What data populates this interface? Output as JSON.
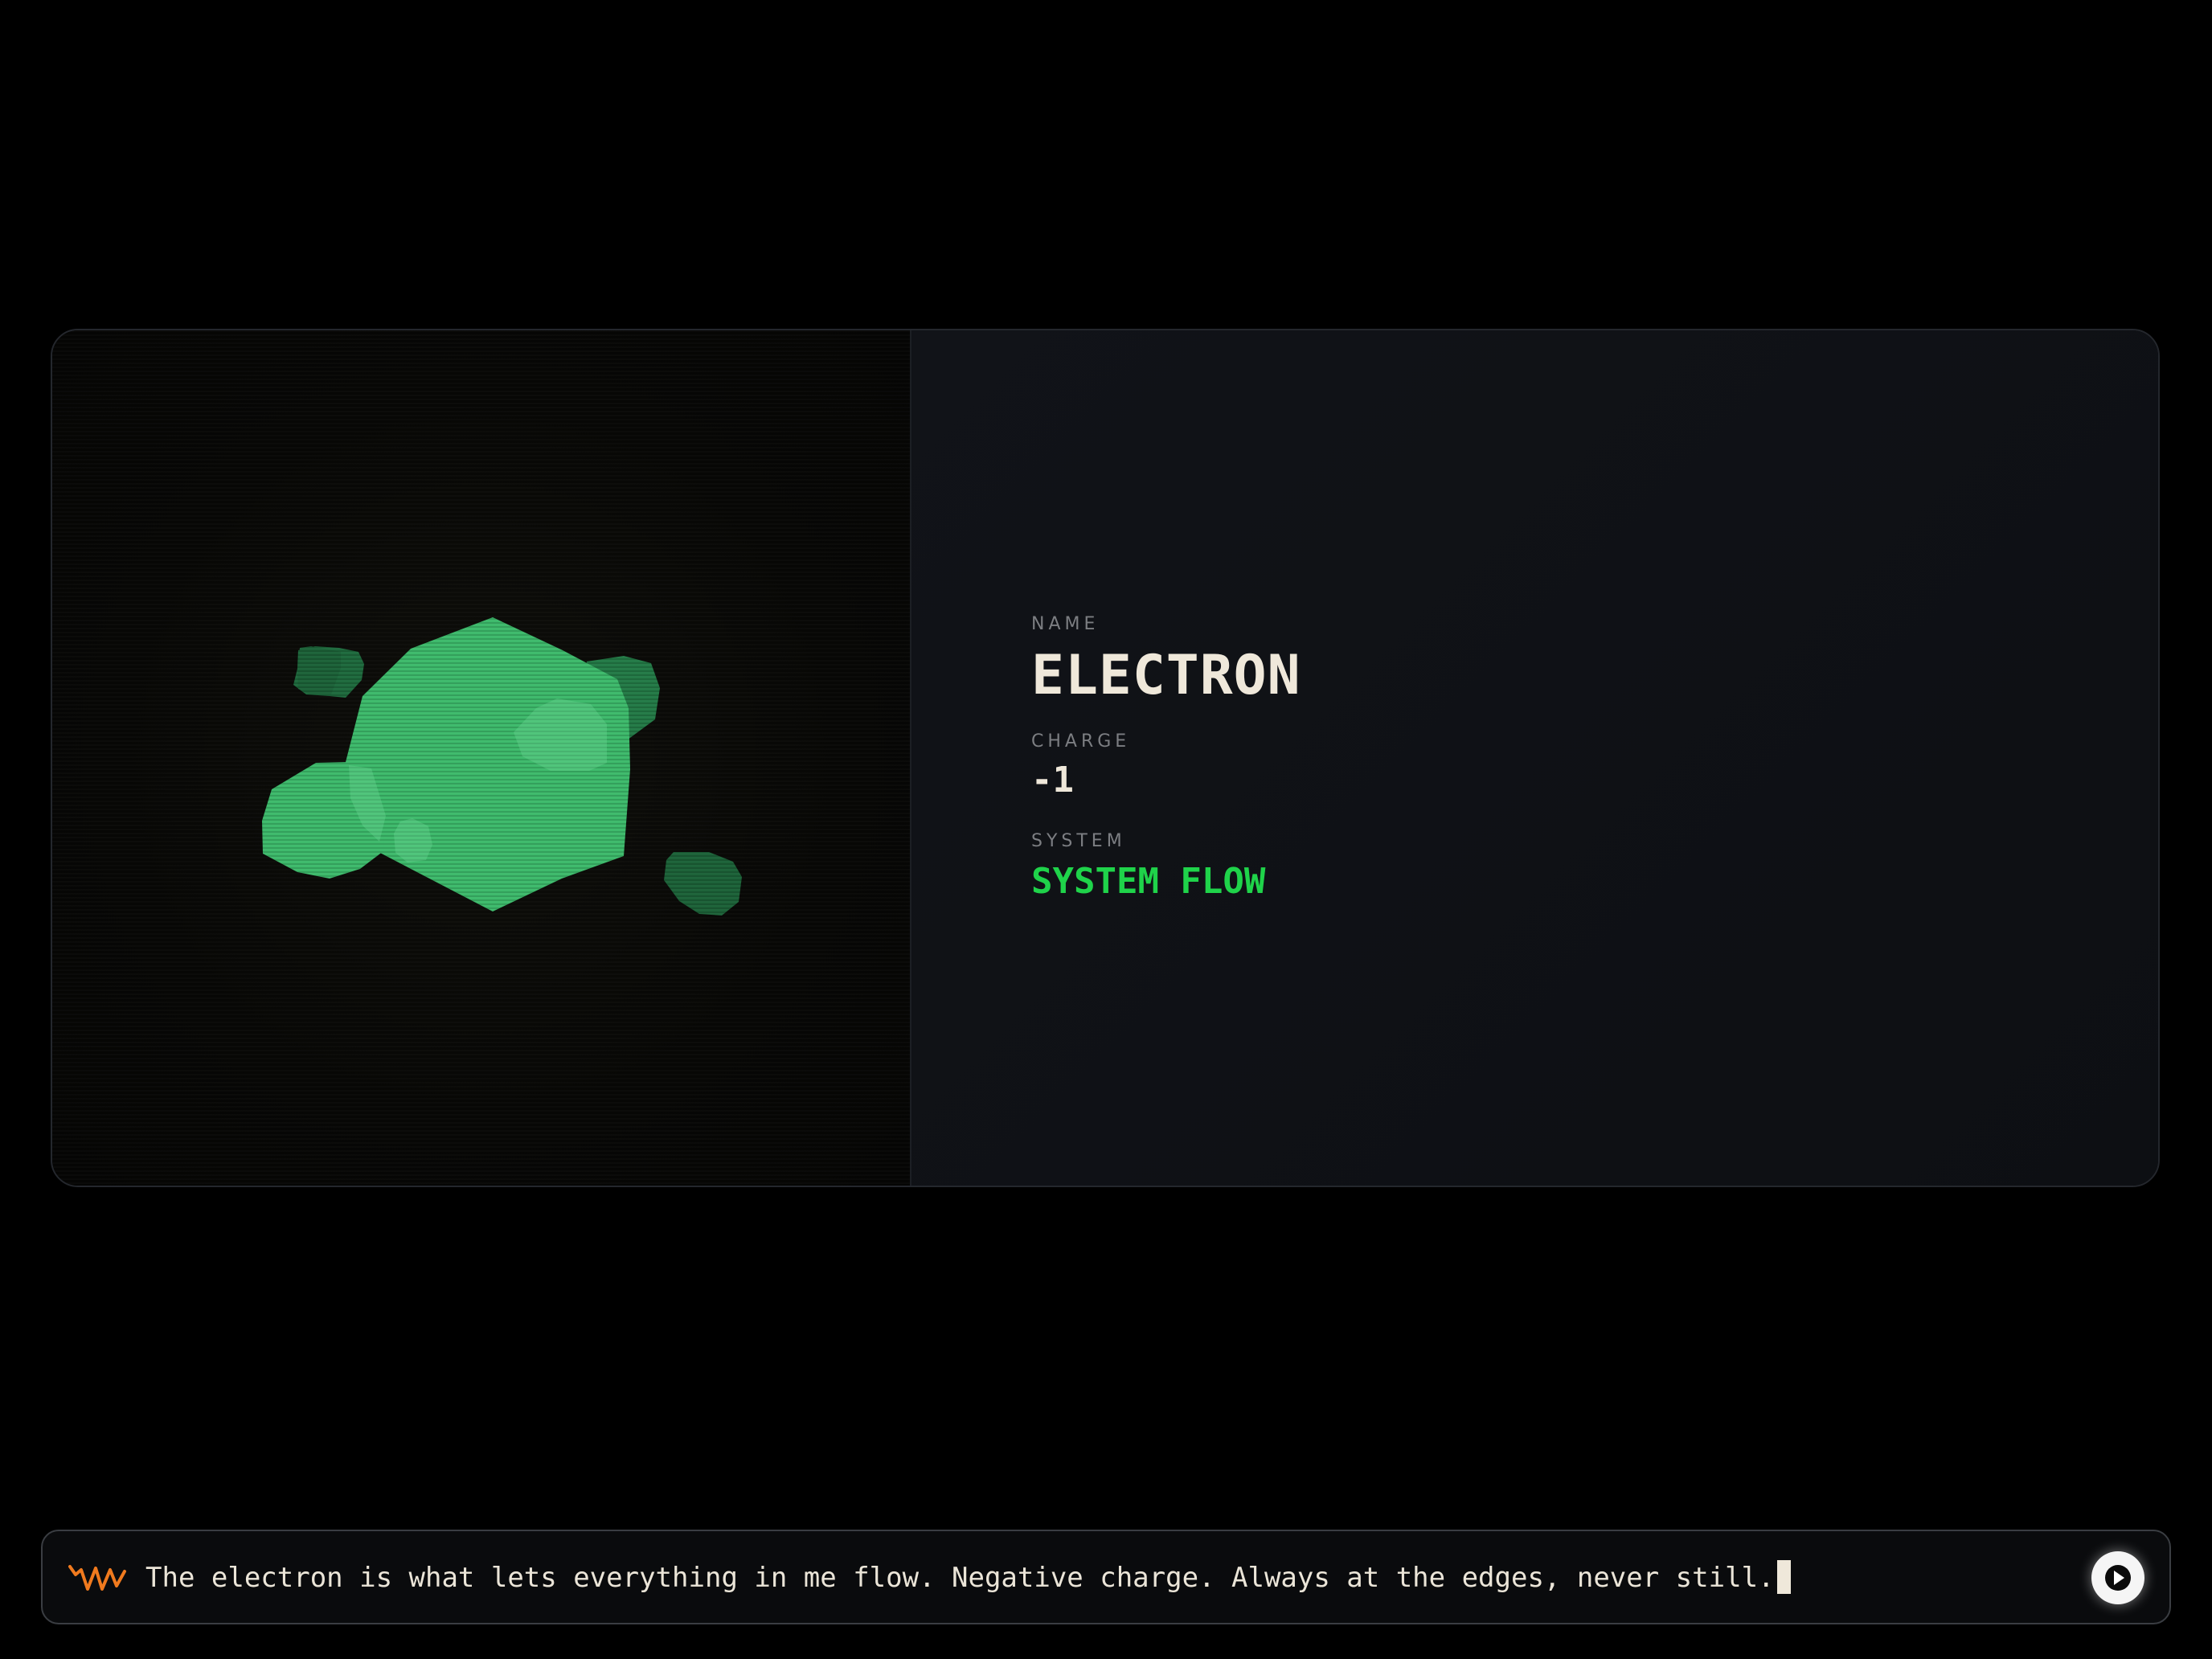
{
  "particle": {
    "name_label": "NAME",
    "name": "ELECTRON",
    "charge_label": "CHARGE",
    "charge": "-1",
    "system_label": "SYSTEM",
    "system": "SYSTEM FLOW"
  },
  "message_bar": {
    "text": "The electron is what lets everything in me flow. Negative charge. Always at the edges, never still.",
    "wave_icon": "waveform-icon",
    "play_icon": "play-icon"
  },
  "colors": {
    "background": "#000000",
    "accent_green": "#1fd34a",
    "particle_green": "#3dba6b",
    "text_cream": "#efe8da",
    "label_gray": "#7c7e82",
    "wave_orange": "#f07a1e"
  }
}
